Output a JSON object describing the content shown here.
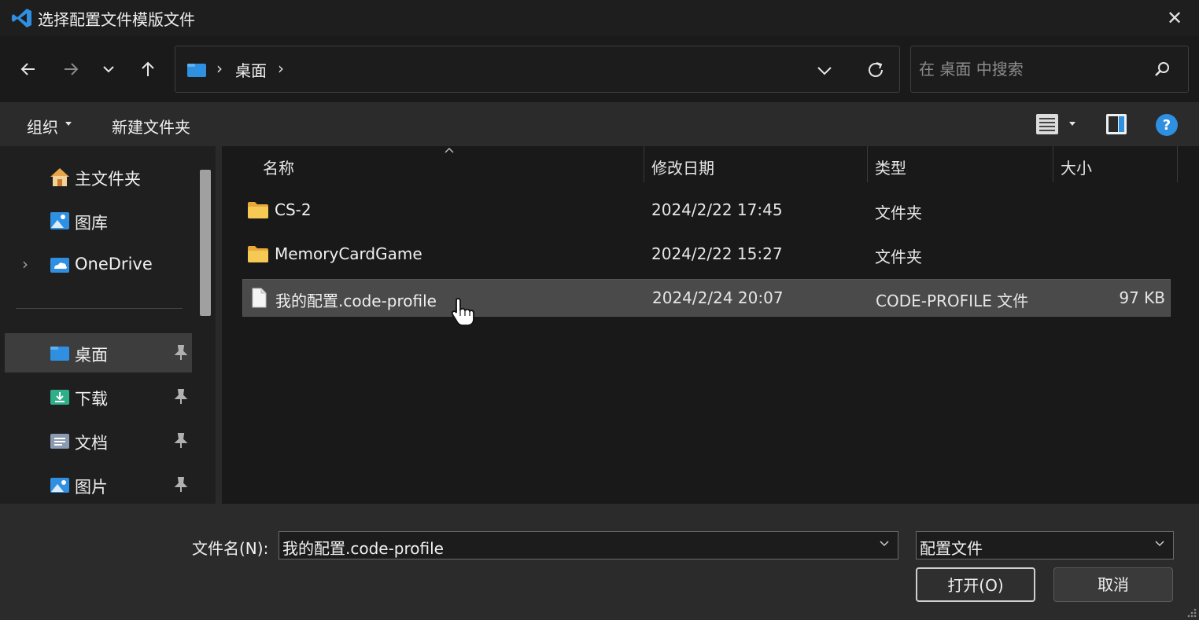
{
  "window": {
    "title": "选择配置文件模版文件"
  },
  "address": {
    "crumb": "桌面"
  },
  "search": {
    "placeholder": "在 桌面 中搜索"
  },
  "toolbar": {
    "organize_label": "组织",
    "new_folder_label": "新建文件夹"
  },
  "sidebar": {
    "items": [
      {
        "label": "主文件夹",
        "icon": "home-icon"
      },
      {
        "label": "图库",
        "icon": "gallery-icon"
      },
      {
        "label": "OneDrive",
        "icon": "onedrive-icon"
      },
      {
        "label": "桌面",
        "icon": "desktop-folder-icon"
      },
      {
        "label": "下载",
        "icon": "downloads-icon"
      },
      {
        "label": "文档",
        "icon": "documents-icon"
      },
      {
        "label": "图片",
        "icon": "pictures-icon"
      }
    ]
  },
  "columns": {
    "name": "名称",
    "modified": "修改日期",
    "type": "类型",
    "size": "大小"
  },
  "files": [
    {
      "name": "CS-2",
      "modified": "2024/2/22 17:45",
      "type": "文件夹",
      "size": "",
      "icon": "folder-icon"
    },
    {
      "name": "MemoryCardGame",
      "modified": "2024/2/22 15:27",
      "type": "文件夹",
      "size": "",
      "icon": "folder-icon"
    },
    {
      "name": "我的配置.code-profile",
      "modified": "2024/2/24 20:07",
      "type": "CODE-PROFILE 文件",
      "size": "97 KB",
      "icon": "file-icon"
    }
  ],
  "footer": {
    "filename_label": "文件名(N):",
    "filename_value": "我的配置.code-profile",
    "filetype_value": "配置文件",
    "open_label": "打开(O)",
    "cancel_label": "取消"
  },
  "colors": {
    "accent": "#2f8fe0",
    "folder": "#f3c04a",
    "selection": "#4a4a4a"
  }
}
